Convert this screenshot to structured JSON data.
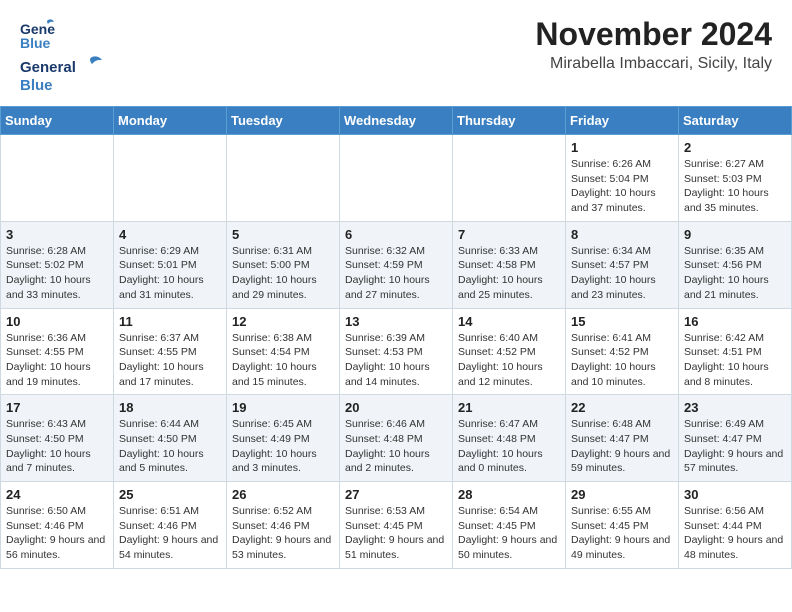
{
  "header": {
    "logo_general": "General",
    "logo_blue": "Blue",
    "month_title": "November 2024",
    "location": "Mirabella Imbaccari, Sicily, Italy"
  },
  "weekdays": [
    "Sunday",
    "Monday",
    "Tuesday",
    "Wednesday",
    "Thursday",
    "Friday",
    "Saturday"
  ],
  "weeks": [
    [
      {
        "day": "",
        "lines": []
      },
      {
        "day": "",
        "lines": []
      },
      {
        "day": "",
        "lines": []
      },
      {
        "day": "",
        "lines": []
      },
      {
        "day": "",
        "lines": []
      },
      {
        "day": "1",
        "lines": [
          "Sunrise: 6:26 AM",
          "Sunset: 5:04 PM",
          "Daylight: 10 hours and 37 minutes."
        ]
      },
      {
        "day": "2",
        "lines": [
          "Sunrise: 6:27 AM",
          "Sunset: 5:03 PM",
          "Daylight: 10 hours and 35 minutes."
        ]
      }
    ],
    [
      {
        "day": "3",
        "lines": [
          "Sunrise: 6:28 AM",
          "Sunset: 5:02 PM",
          "Daylight: 10 hours and 33 minutes."
        ]
      },
      {
        "day": "4",
        "lines": [
          "Sunrise: 6:29 AM",
          "Sunset: 5:01 PM",
          "Daylight: 10 hours and 31 minutes."
        ]
      },
      {
        "day": "5",
        "lines": [
          "Sunrise: 6:31 AM",
          "Sunset: 5:00 PM",
          "Daylight: 10 hours and 29 minutes."
        ]
      },
      {
        "day": "6",
        "lines": [
          "Sunrise: 6:32 AM",
          "Sunset: 4:59 PM",
          "Daylight: 10 hours and 27 minutes."
        ]
      },
      {
        "day": "7",
        "lines": [
          "Sunrise: 6:33 AM",
          "Sunset: 4:58 PM",
          "Daylight: 10 hours and 25 minutes."
        ]
      },
      {
        "day": "8",
        "lines": [
          "Sunrise: 6:34 AM",
          "Sunset: 4:57 PM",
          "Daylight: 10 hours and 23 minutes."
        ]
      },
      {
        "day": "9",
        "lines": [
          "Sunrise: 6:35 AM",
          "Sunset: 4:56 PM",
          "Daylight: 10 hours and 21 minutes."
        ]
      }
    ],
    [
      {
        "day": "10",
        "lines": [
          "Sunrise: 6:36 AM",
          "Sunset: 4:55 PM",
          "Daylight: 10 hours and 19 minutes."
        ]
      },
      {
        "day": "11",
        "lines": [
          "Sunrise: 6:37 AM",
          "Sunset: 4:55 PM",
          "Daylight: 10 hours and 17 minutes."
        ]
      },
      {
        "day": "12",
        "lines": [
          "Sunrise: 6:38 AM",
          "Sunset: 4:54 PM",
          "Daylight: 10 hours and 15 minutes."
        ]
      },
      {
        "day": "13",
        "lines": [
          "Sunrise: 6:39 AM",
          "Sunset: 4:53 PM",
          "Daylight: 10 hours and 14 minutes."
        ]
      },
      {
        "day": "14",
        "lines": [
          "Sunrise: 6:40 AM",
          "Sunset: 4:52 PM",
          "Daylight: 10 hours and 12 minutes."
        ]
      },
      {
        "day": "15",
        "lines": [
          "Sunrise: 6:41 AM",
          "Sunset: 4:52 PM",
          "Daylight: 10 hours and 10 minutes."
        ]
      },
      {
        "day": "16",
        "lines": [
          "Sunrise: 6:42 AM",
          "Sunset: 4:51 PM",
          "Daylight: 10 hours and 8 minutes."
        ]
      }
    ],
    [
      {
        "day": "17",
        "lines": [
          "Sunrise: 6:43 AM",
          "Sunset: 4:50 PM",
          "Daylight: 10 hours and 7 minutes."
        ]
      },
      {
        "day": "18",
        "lines": [
          "Sunrise: 6:44 AM",
          "Sunset: 4:50 PM",
          "Daylight: 10 hours and 5 minutes."
        ]
      },
      {
        "day": "19",
        "lines": [
          "Sunrise: 6:45 AM",
          "Sunset: 4:49 PM",
          "Daylight: 10 hours and 3 minutes."
        ]
      },
      {
        "day": "20",
        "lines": [
          "Sunrise: 6:46 AM",
          "Sunset: 4:48 PM",
          "Daylight: 10 hours and 2 minutes."
        ]
      },
      {
        "day": "21",
        "lines": [
          "Sunrise: 6:47 AM",
          "Sunset: 4:48 PM",
          "Daylight: 10 hours and 0 minutes."
        ]
      },
      {
        "day": "22",
        "lines": [
          "Sunrise: 6:48 AM",
          "Sunset: 4:47 PM",
          "Daylight: 9 hours and 59 minutes."
        ]
      },
      {
        "day": "23",
        "lines": [
          "Sunrise: 6:49 AM",
          "Sunset: 4:47 PM",
          "Daylight: 9 hours and 57 minutes."
        ]
      }
    ],
    [
      {
        "day": "24",
        "lines": [
          "Sunrise: 6:50 AM",
          "Sunset: 4:46 PM",
          "Daylight: 9 hours and 56 minutes."
        ]
      },
      {
        "day": "25",
        "lines": [
          "Sunrise: 6:51 AM",
          "Sunset: 4:46 PM",
          "Daylight: 9 hours and 54 minutes."
        ]
      },
      {
        "day": "26",
        "lines": [
          "Sunrise: 6:52 AM",
          "Sunset: 4:46 PM",
          "Daylight: 9 hours and 53 minutes."
        ]
      },
      {
        "day": "27",
        "lines": [
          "Sunrise: 6:53 AM",
          "Sunset: 4:45 PM",
          "Daylight: 9 hours and 51 minutes."
        ]
      },
      {
        "day": "28",
        "lines": [
          "Sunrise: 6:54 AM",
          "Sunset: 4:45 PM",
          "Daylight: 9 hours and 50 minutes."
        ]
      },
      {
        "day": "29",
        "lines": [
          "Sunrise: 6:55 AM",
          "Sunset: 4:45 PM",
          "Daylight: 9 hours and 49 minutes."
        ]
      },
      {
        "day": "30",
        "lines": [
          "Sunrise: 6:56 AM",
          "Sunset: 4:44 PM",
          "Daylight: 9 hours and 48 minutes."
        ]
      }
    ]
  ]
}
